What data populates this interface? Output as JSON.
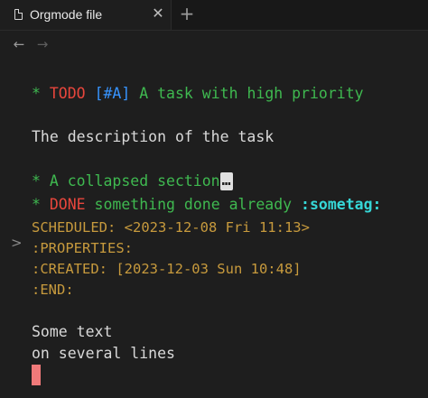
{
  "tab": {
    "title": "Orgmode file",
    "close_glyph": "✕",
    "new_tab_glyph": "+"
  },
  "nav": {
    "back_glyph": "←",
    "forward_glyph": "→"
  },
  "editor": {
    "line1": {
      "star": "* ",
      "keyword": "TODO",
      "space1": " ",
      "priority": "[#A]",
      "title": " A task with high priority"
    },
    "line2": "The description of the task",
    "line3": {
      "fold_glyph": ">",
      "text": "* A collapsed section",
      "ellipsis": "…"
    },
    "line4": {
      "star": "* ",
      "keyword": "DONE",
      "title": " something done already ",
      "tag": ":sometag:"
    },
    "line5": "SCHEDULED: <2023-12-08 Fri 11:13>",
    "line6": ":PROPERTIES:",
    "line7": ":CREATED: [2023-12-03 Sun 10:48]",
    "line8": ":END:",
    "line9": "Some text",
    "line10": "on several lines"
  },
  "colors": {
    "headline_green": "#3fb950",
    "todo_red": "#e8463c",
    "priority_blue": "#3794ff",
    "tag_cyan": "#36d7d7",
    "meta_gold": "#c79a3d",
    "cursor_red": "#f07a7a"
  }
}
